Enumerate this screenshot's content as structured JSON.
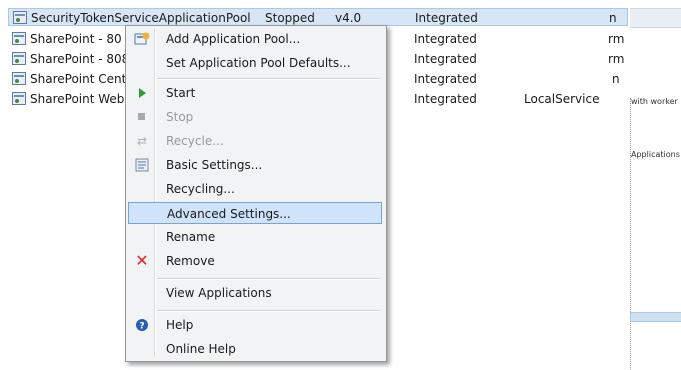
{
  "pools": [
    {
      "name": "SecurityTokenServiceApplicationPool",
      "status": "Stopped",
      "clr": "v4.0",
      "mode": "Integrated",
      "identity": "n",
      "selected": true
    },
    {
      "name": "SharePoint - 80",
      "status": "",
      "clr": "",
      "mode": "Integrated",
      "identity": "rm",
      "selected": false
    },
    {
      "name": "SharePoint - 808",
      "status": "",
      "clr": "",
      "mode": "Integrated",
      "identity": "rm",
      "selected": false
    },
    {
      "name": "SharePoint Cent",
      "status": "",
      "clr": "",
      "mode": "Integrated",
      "identity": "n",
      "selected": false
    },
    {
      "name": "SharePoint Web",
      "status": "",
      "clr": "",
      "mode": "Integrated",
      "identity": "LocalService",
      "selected": false
    }
  ],
  "side_panel": {
    "worker_text": "with worker",
    "applications_header": "Applications"
  },
  "menu": {
    "items": [
      {
        "label": "Add Application Pool...",
        "icon": "add-pool-icon",
        "disabled": false
      },
      {
        "label": "Set Application Pool Defaults...",
        "icon": "",
        "disabled": false
      },
      {
        "label": "Start",
        "icon": "start-icon",
        "disabled": false
      },
      {
        "label": "Stop",
        "icon": "stop-icon",
        "disabled": true
      },
      {
        "label": "Recycle...",
        "icon": "recycle-icon",
        "disabled": true
      },
      {
        "label": "Basic Settings...",
        "icon": "settings-icon",
        "disabled": false
      },
      {
        "label": "Recycling...",
        "icon": "",
        "disabled": false
      },
      {
        "label": "Advanced Settings...",
        "icon": "",
        "disabled": false,
        "highlighted": true
      },
      {
        "label": "Rename",
        "icon": "",
        "disabled": false
      },
      {
        "label": "Remove",
        "icon": "remove-icon",
        "disabled": false
      },
      {
        "label": "View Applications",
        "icon": "",
        "disabled": false
      },
      {
        "label": "Help",
        "icon": "help-icon",
        "disabled": false
      },
      {
        "label": "Online Help",
        "icon": "",
        "disabled": false
      }
    ]
  },
  "colors": {
    "selection": "#d6e6f7",
    "menu_highlight": "#cfe3fb",
    "start_green": "#2e9e2e",
    "remove_red": "#d9262b",
    "help_blue": "#2a5db0"
  }
}
